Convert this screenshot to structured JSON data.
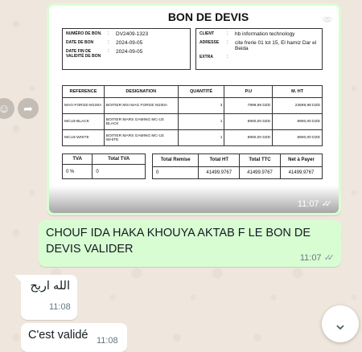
{
  "image_message": {
    "time": "11:07",
    "document": {
      "title": "BON DE DEVIS",
      "labels": {
        "num": "NUMÉRO DE BON.",
        "date": "DATE DE BON",
        "date_fin": "DATE FIN DE VALIDITÉ DE BON",
        "client": "CLIENT",
        "adresse": "ADRESSE",
        "extra": "EXTRA"
      },
      "values": {
        "num": "DV2409-1323",
        "date": "2024-09-05",
        "date_fin": "2024-09-05",
        "client": "hb information technology",
        "adresse": "cite frerie 01 lot 15, El hamiz Dar el Beida",
        "extra": ""
      },
      "columns": [
        "REFERENCE",
        "DESIGNATION",
        "QUANTITÉ",
        "P.U",
        "M. HT"
      ],
      "rows": [
        [
          "MAG-FORGE-M100A",
          "BOITIER MSI MAG FORGE M100A",
          "3",
          "7899,99 DZD",
          "23699,98 DZD"
        ],
        [
          "MCU3-BLACK",
          "BOITIER MARS GAMING MC-U3 BLACK",
          "1",
          "8900,00 DZD",
          "8900,00 DZD"
        ],
        [
          "MCU3-WHITE",
          "BOITIER MARS GAMING MC-U3 WHITE",
          "1",
          "8900,00 DZD",
          "8900,00 DZD"
        ]
      ],
      "tva": {
        "headers": [
          "TVA",
          "Total TVA"
        ],
        "values": [
          "0 %",
          "0"
        ]
      },
      "totals": {
        "headers": [
          "Total Remise",
          "Total HT",
          "Total TTC",
          "Net à Payer"
        ],
        "values": [
          "0",
          "41499.9767",
          "41499.9767",
          "41499.9767"
        ]
      }
    }
  },
  "out_message": {
    "text": "CHOUF IDA HAKA KHOUYA AKTAB F LE BON DE DEVIS VALIDER",
    "time": "11:07"
  },
  "in_messages": [
    {
      "text": "الله اربح",
      "time": "11:08"
    },
    {
      "text": "C'est validé",
      "time": "11:08"
    }
  ],
  "icons": {
    "emoji": "emoji-icon",
    "forward": "forward-icon",
    "scroll_down": "chevron-down-icon",
    "read_receipt": "double-check-icon"
  },
  "colors": {
    "outgoing_bubble": "#d9fdd3",
    "incoming_bubble": "#ffffff",
    "background": "#efe7dd"
  }
}
